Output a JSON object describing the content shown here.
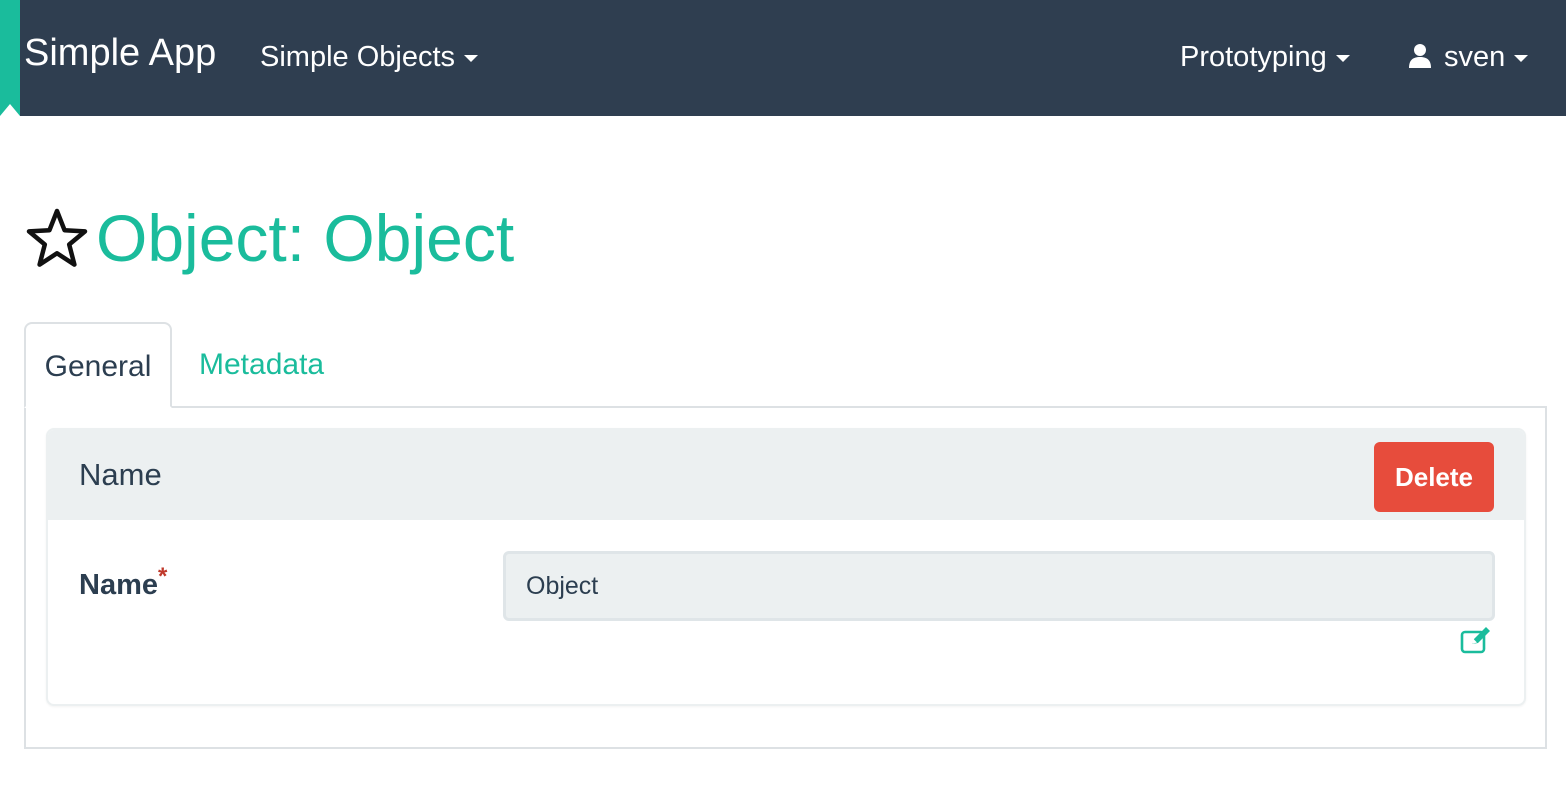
{
  "navbar": {
    "brand": "Simple App",
    "menu": {
      "simple_objects": "Simple Objects"
    },
    "right": {
      "prototyping": "Prototyping",
      "user": "sven"
    },
    "background_color": "#2f3e50",
    "accent_color": "#1abc9c"
  },
  "page": {
    "title": "Object: Object",
    "favorite_icon": "star-outline-icon"
  },
  "tabs": [
    {
      "label": "General",
      "active": true
    },
    {
      "label": "Metadata",
      "active": false
    }
  ],
  "panel": {
    "heading": "Name",
    "delete_label": "Delete",
    "field": {
      "label": "Name",
      "required_mark": "*",
      "value": "Object",
      "edit_icon": "edit-icon"
    }
  },
  "colors": {
    "accent": "#1abc9c",
    "danger": "#e74c3c",
    "text": "#2c3e50",
    "panel_bg": "#ecf0f1"
  }
}
